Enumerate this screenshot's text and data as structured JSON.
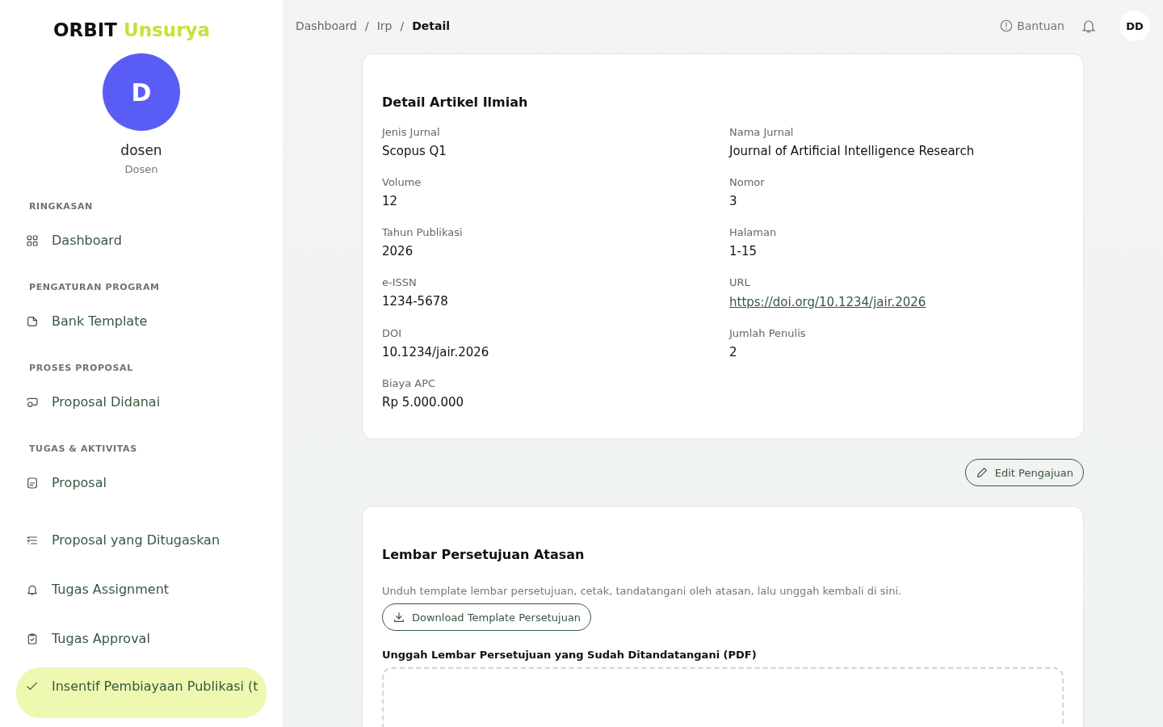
{
  "brand": {
    "name": "ORBIT",
    "accent": "Unsurya"
  },
  "user": {
    "initial": "D",
    "name": "dosen",
    "role": "Dosen"
  },
  "sidebar": {
    "sections": [
      {
        "title": "RINGKASAN",
        "items": [
          {
            "label": "Dashboard",
            "selected": false
          }
        ]
      },
      {
        "title": "PENGATURAN PROGRAM",
        "items": [
          {
            "label": "Bank Template",
            "selected": false
          }
        ]
      },
      {
        "title": "PROSES PROPOSAL",
        "items": [
          {
            "label": "Proposal Didanai",
            "selected": false
          }
        ]
      },
      {
        "title": "TUGAS & AKTIVITAS",
        "items": [
          {
            "label": "Proposal",
            "selected": false
          },
          {
            "label": "Proposal yang Ditugaskan",
            "selected": false
          },
          {
            "label": "Tugas Assignment",
            "selected": false
          },
          {
            "label": "Tugas Approval",
            "selected": false
          },
          {
            "label": "Insentif Pembiayaan Publikasi (t",
            "selected": true
          }
        ]
      }
    ]
  },
  "breadcrumb": [
    {
      "label": "Dashboard",
      "current": false
    },
    {
      "label": "Irp",
      "current": false
    },
    {
      "label": "Detail",
      "current": true
    }
  ],
  "breadcrumb_separators": [
    "/",
    "/"
  ],
  "header": {
    "help": "Bantuan",
    "avatar": "DD"
  },
  "detail_card": {
    "title": "Detail Artikel Ilmiah",
    "fields": [
      {
        "label": "Jenis Jurnal",
        "value": "Scopus Q1",
        "kind": "text"
      },
      {
        "label": "Nama Jurnal",
        "value": "Journal of Artificial Intelligence Research",
        "kind": "text"
      },
      {
        "label": "Volume",
        "value": "12",
        "kind": "text"
      },
      {
        "label": "Nomor",
        "value": "3",
        "kind": "text"
      },
      {
        "label": "Tahun Publikasi",
        "value": "2026",
        "kind": "text"
      },
      {
        "label": "Halaman",
        "value": "1-15",
        "kind": "text"
      },
      {
        "label": "e-ISSN",
        "value": "1234-5678",
        "kind": "text"
      },
      {
        "label": "URL",
        "value": "https://doi.org/10.1234/jair.2026",
        "kind": "link"
      },
      {
        "label": "DOI",
        "value": "10.1234/jair.2026",
        "kind": "text"
      },
      {
        "label": "Jumlah Penulis",
        "value": "2",
        "kind": "text"
      },
      {
        "label": "Biaya APC",
        "value": "Rp 5.000.000",
        "kind": "text"
      }
    ]
  },
  "edit_button": "Edit Pengajuan",
  "approval_card": {
    "title": "Lembar Persetujuan Atasan",
    "description": "Unduh template lembar persetujuan, cetak, tandatangani oleh atasan, lalu unggah kembali di sini.",
    "download_button": "Download Template Persetujuan",
    "upload_label": "Unggah Lembar Persetujuan yang Sudah Ditandatangani (PDF)"
  }
}
